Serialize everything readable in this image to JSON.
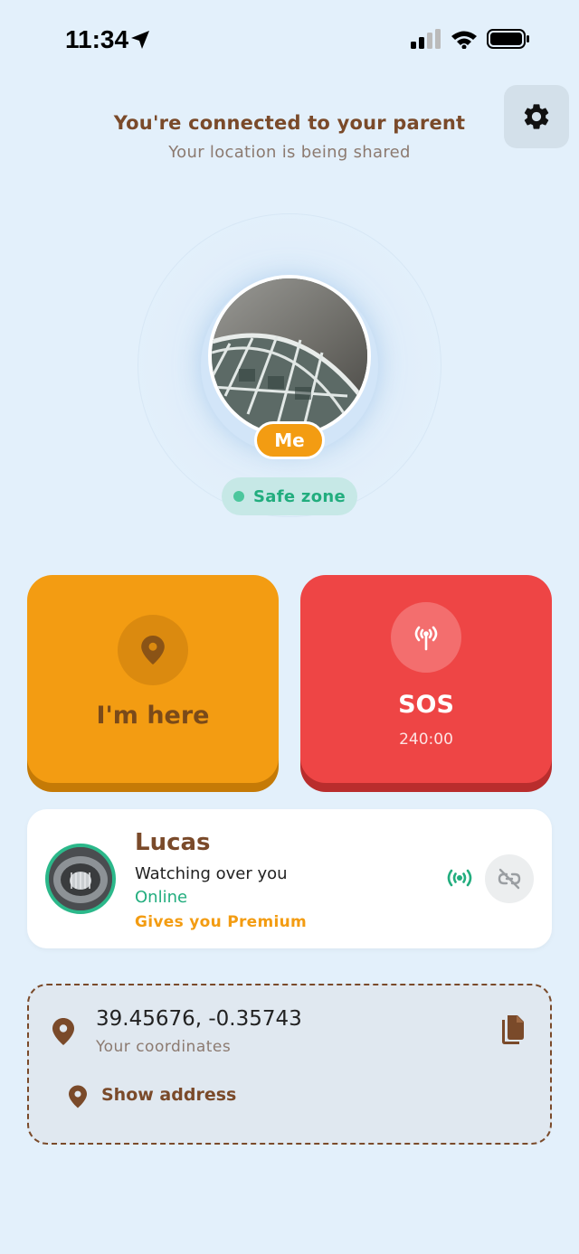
{
  "status_bar": {
    "time": "11:34"
  },
  "header": {
    "title": "You're connected to your parent",
    "subtitle": "Your location is being shared"
  },
  "me": {
    "badge": "Me",
    "zone": "Safe zone"
  },
  "actions": {
    "here_label": "I'm here",
    "sos_label": "SOS",
    "sos_timer": "240:00"
  },
  "parent": {
    "name": "Lucas",
    "role": "Watching over you",
    "status": "Online",
    "premium": "Gives you Premium"
  },
  "coordinates": {
    "value": "39.45676, -0.35743",
    "label": "Your coordinates",
    "address_label": "Show address"
  },
  "colors": {
    "background": "#e3f0fb",
    "brown": "#7a4a2a",
    "orange": "#f39c12",
    "red": "#ee4545",
    "green": "#22ad7e"
  },
  "icons": [
    "location-arrow-icon",
    "signal-icon",
    "wifi-icon",
    "battery-icon",
    "gear-icon",
    "map-pin-icon",
    "broadcast-icon",
    "unlink-icon",
    "copy-icon"
  ]
}
